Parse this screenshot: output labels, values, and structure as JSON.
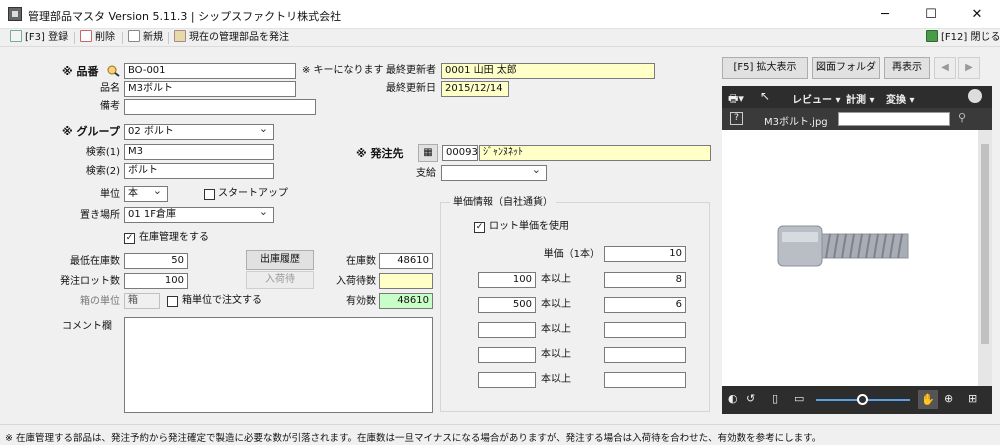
{
  "window": {
    "title": "管理部品マスタ Version 5.11.3 | シップスファクトリ株式会社"
  },
  "toolbar": {
    "register": "[F3] 登録",
    "delete": "削除",
    "new": "新規",
    "order_current": "現在の管理部品を発注",
    "close": "[F12] 閉じる"
  },
  "form": {
    "part_no_label": "※ 品番",
    "part_no_value": "BO-001",
    "key_note": "※ キーになります",
    "name_label": "品名",
    "name_value": "M3ボルト",
    "remarks_label": "備考",
    "remarks_value": "",
    "updater_label": "最終更新者",
    "updater_value": "0001 山田 太郎",
    "updated_label": "最終更新日",
    "updated_value": "2015/12/14",
    "group_label": "※ グループ",
    "group_value": "02 ボルト",
    "search1_label": "検索(1)",
    "search1_value": "M3",
    "search2_label": "検索(2)",
    "search2_value": "ボルト",
    "supplier_label": "※ 発注先",
    "supplier_code": "00093",
    "supplier_name": "ｼﾞｬﾝﾇﾈｯﾄ",
    "supply_label": "支給",
    "supply_value": "",
    "unit_label": "単位",
    "unit_value": "本",
    "startup_label": "スタートアップ",
    "location_label": "置き場所",
    "location_value": "01 1F倉庫",
    "stock_manage_label": "在庫管理をする",
    "min_stock_label": "最低在庫数",
    "min_stock_value": "50",
    "lot_label": "発注ロット数",
    "lot_value": "100",
    "box_unit_label": "箱の単位",
    "box_unit_value": "箱",
    "box_order_label": "箱単位で注文する",
    "history_button": "出庫履歴",
    "receive_button": "入荷待",
    "stock_label": "在庫数",
    "stock_value": "48610",
    "incoming_label": "入荷待数",
    "incoming_value": "",
    "effective_label": "有効数",
    "effective_value": "48610",
    "comment_label": "コメント欄",
    "comment_value": ""
  },
  "price": {
    "group_title": "単価情報（自社通貨）",
    "lot_price_label": "ロット単価を使用",
    "unit_price_label": "単価（1本）",
    "unit_price_value": "10",
    "above_label": "本以上",
    "tiers": [
      {
        "qty": "100",
        "price": "8"
      },
      {
        "qty": "500",
        "price": "6"
      },
      {
        "qty": "",
        "price": ""
      },
      {
        "qty": "",
        "price": ""
      },
      {
        "qty": "",
        "price": ""
      }
    ]
  },
  "right": {
    "expand_button": "[F5] 拡大表示",
    "folder_button": "図面フォルダ",
    "refresh_button": "再表示",
    "viewer": {
      "review_menu": "レビュー",
      "measure_menu": "計測",
      "convert_menu": "変換",
      "file_name": "M3ボルト.jpg"
    }
  },
  "status": {
    "text": "※ 在庫管理する部品は、発注予約から発注確定で製造に必要な数が引落されます。在庫数は一旦マイナスになる場合がありますが、発注する場合は入荷待を合わせた、有効数を参考にします。"
  }
}
